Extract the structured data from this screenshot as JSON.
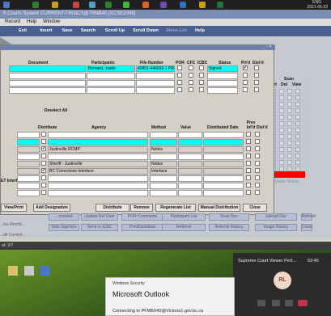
{
  "tray": {
    "lang": "ENG",
    "date": "2021-06-22"
  },
  "app": {
    "title": "ft Courts System CURRENT/TRNICS@TRNB40 [XCSE2008]",
    "menu": [
      "Record",
      "Help",
      "Window"
    ],
    "toolbar": [
      "Exit",
      "Insert",
      "Save",
      "Search",
      "Scroll Up",
      "Scroll Down",
      "Show List",
      "Help"
    ]
  },
  "doc_table": {
    "headers": [
      "Document",
      "Participants",
      "File Number",
      "POR",
      "CFC",
      "ICBC",
      "Status",
      "Prt'd",
      "Dist'd"
    ],
    "rows": [
      {
        "participants": "Bernard, Justin",
        "file_number": "40801-446569-1 PRA",
        "status": "Signed",
        "prtd": "✔"
      },
      {},
      {},
      {}
    ],
    "deselect_all": "Deselect All"
  },
  "scan": {
    "title": "Scan",
    "cols": [
      "Prt",
      "Dnl",
      "View"
    ]
  },
  "dist_table": {
    "headers": [
      "Distribute",
      "Agency",
      "Method",
      "Value",
      "Distributed Date",
      "Prev Inf'd",
      "Dist'd"
    ],
    "left_label": "ET Interface",
    "rows": [
      {
        "agency": "",
        "method": ""
      },
      {
        "agency": "",
        "method": ""
      },
      {
        "agency": "Justinville RCMP",
        "method": "Notice",
        "checked": "✔"
      },
      {
        "agency": "",
        "method": ""
      },
      {
        "agency": "Sheriff - Justinville",
        "method": "Notice"
      },
      {
        "agency": "BC Corrections Interface",
        "method": "Interface",
        "checked": "✔"
      },
      {
        "agency": "",
        "method": ""
      },
      {
        "agency": "",
        "method": ""
      },
      {
        "agency": "",
        "method": ""
      }
    ]
  },
  "dialog_buttons": [
    "View/Print",
    "Add Designation",
    "Distribute",
    "Remove",
    "Regenerate List",
    "Manual Distribution",
    "Close"
  ],
  "bottom_buttons_row1": [
    "Note",
    "...nvolved",
    "Update Ref Date",
    "POR Comments",
    "Participant List",
    "Scan Doc",
    "Upload Doc",
    "Refresh"
  ],
  "bottom_buttons_row2": [
    "...Produce Doc",
    "View Sign'ture",
    "Send to ICBC",
    "Print/Distribute",
    "Referral",
    "Referral History",
    "Image History",
    "Close"
  ],
  "left_bits": [
    "...tus Recrid...",
    "...dit Current..."
  ],
  "status_stamp": "Status Stamp",
  "record_count": "rd: 2/7",
  "teams": {
    "title": "Supreme Court Viewer Perf...",
    "time": "53:45",
    "initials": "RL"
  },
  "outlook": {
    "header": "Windows Security",
    "title": "Microsoft Outlook",
    "message": "Connecting to PFMBX40@Victoria1.gov.bc.ca"
  }
}
